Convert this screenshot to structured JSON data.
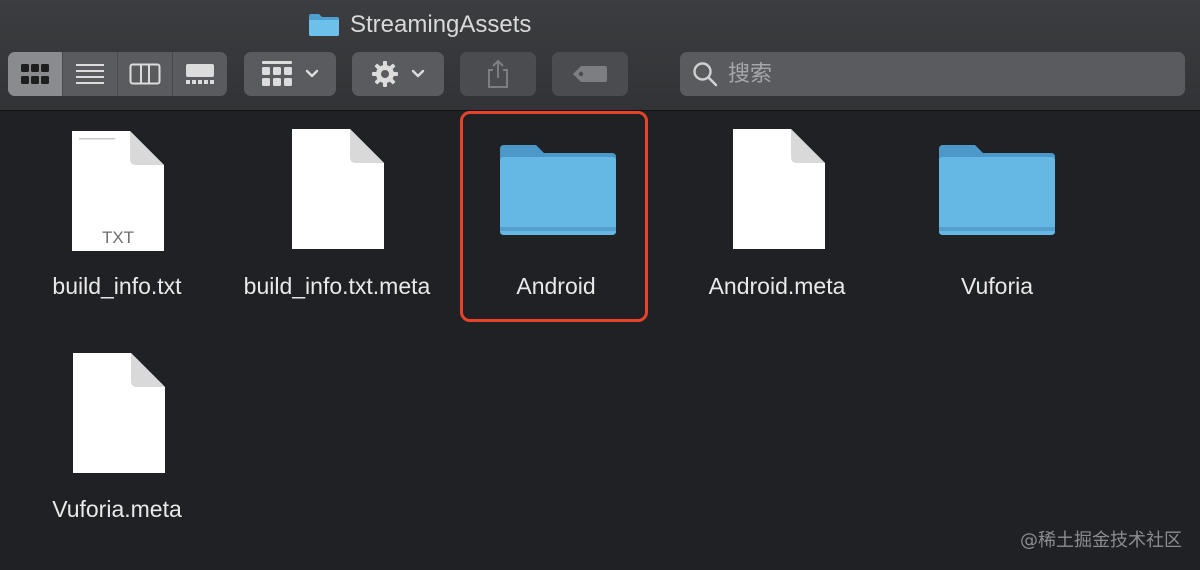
{
  "window": {
    "title": "StreamingAssets"
  },
  "toolbar": {
    "view_modes": [
      "icon-view",
      "list-view",
      "column-view",
      "gallery-view"
    ],
    "active_view": "icon-view",
    "search_placeholder": "搜索"
  },
  "files": [
    {
      "name": "build_info.txt",
      "kind": "document",
      "badge": "TXT"
    },
    {
      "name": "build_info.txt.meta",
      "kind": "document",
      "badge": ""
    },
    {
      "name": "Android",
      "kind": "folder",
      "badge": "",
      "selected": true
    },
    {
      "name": "Android.meta",
      "kind": "document",
      "badge": ""
    },
    {
      "name": "Vuforia",
      "kind": "folder",
      "badge": ""
    },
    {
      "name": "Vuforia.meta",
      "kind": "document",
      "badge": ""
    }
  ],
  "watermark": "@稀土掘金技术社区",
  "colors": {
    "background": "#1f2125",
    "toolbar": "#38393c",
    "folder_blue": "#5fb3e0",
    "selection_outline": "#e7432a"
  }
}
